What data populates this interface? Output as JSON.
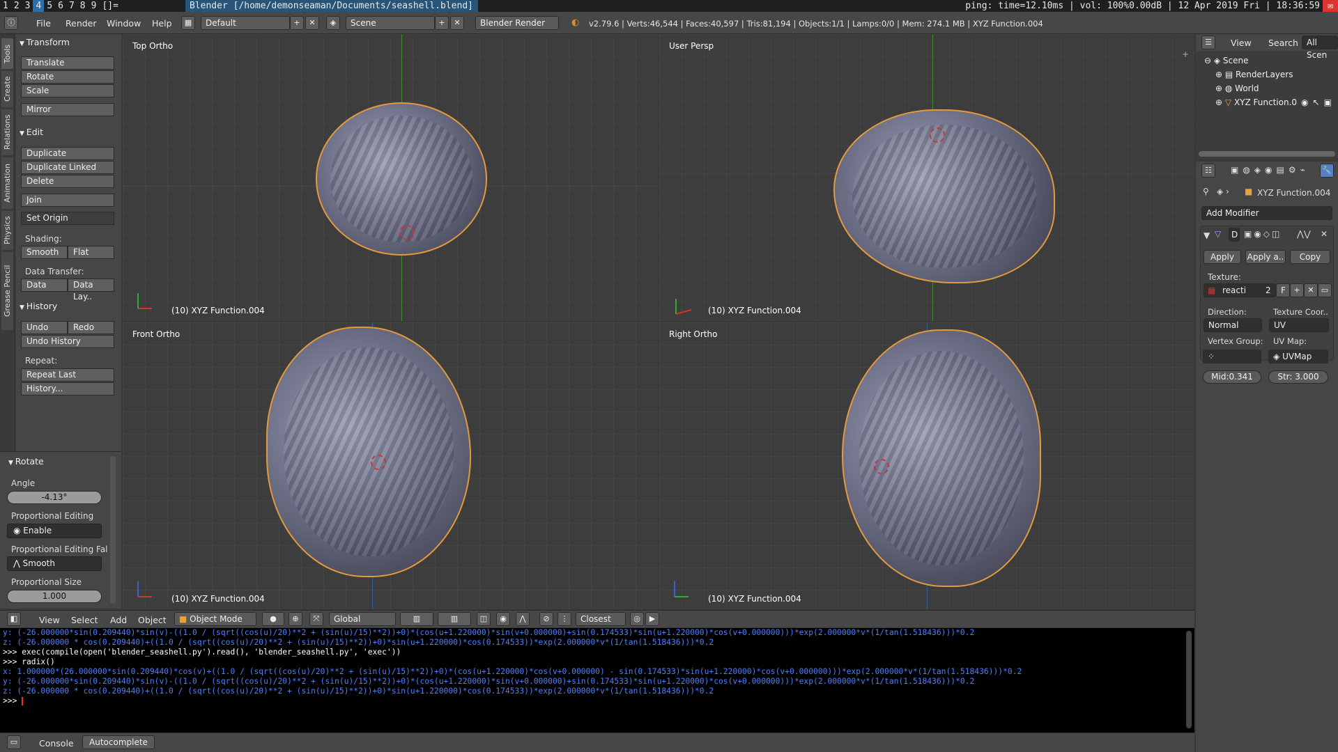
{
  "sysbar": {
    "workspaces": [
      "1",
      "2",
      "3",
      "4",
      "5",
      "6",
      "7",
      "8",
      "9"
    ],
    "active_workspace": "4",
    "layout_indicator": "[]=",
    "window_title": "Blender [/home/demonseaman/Documents/seashell.blend]",
    "status": "ping: time=12.10ms  |  vol: 100%0.00dB  |  12 Apr 2019 Fri  |  18:36:59"
  },
  "infobar": {
    "menus": [
      "File",
      "Render",
      "Window",
      "Help"
    ],
    "screen_layout": "Default",
    "scene": "Scene",
    "engine": "Blender Render",
    "stats": "v2.79.6 | Verts:46,544 | Faces:40,597 | Tris:81,194 | Objects:1/1 | Lamps:0/0 | Mem: 274.1 MB | XYZ Function.004"
  },
  "toolshelf": {
    "tabs": [
      "Tools",
      "Create",
      "Relations",
      "Animation",
      "Physics",
      "Grease Pencil"
    ],
    "transform": {
      "title": "Transform",
      "translate": "Translate",
      "rotate": "Rotate",
      "scale": "Scale",
      "mirror": "Mirror"
    },
    "edit": {
      "title": "Edit",
      "duplicate": "Duplicate",
      "duplicate_linked": "Duplicate Linked",
      "delete": "Delete",
      "join": "Join",
      "set_origin": "Set Origin",
      "shading_label": "Shading:",
      "smooth": "Smooth",
      "flat": "Flat",
      "data_transfer_label": "Data Transfer:",
      "data": "Data",
      "data_lay": "Data Lay.."
    },
    "history": {
      "title": "History",
      "undo": "Undo",
      "redo": "Redo",
      "undo_history": "Undo History",
      "repeat_label": "Repeat:",
      "repeat_last": "Repeat Last",
      "history_btn": "History..."
    }
  },
  "operator": {
    "title": "Rotate",
    "angle_label": "Angle",
    "angle_value": "-4.13°",
    "prop_edit_label": "Proportional Editing",
    "prop_edit_value": "Enable",
    "prop_falloff_label": "Proportional Editing Fal",
    "prop_falloff_value": "Smooth",
    "prop_size_label": "Proportional Size",
    "prop_size_value": "1.000"
  },
  "viewports": [
    {
      "name": "Top Ortho",
      "object": "(10) XYZ Function.004"
    },
    {
      "name": "User Persp",
      "object": "(10) XYZ Function.004"
    },
    {
      "name": "Front Ortho",
      "object": "(10) XYZ Function.004"
    },
    {
      "name": "Right Ortho",
      "object": "(10) XYZ Function.004"
    }
  ],
  "v3d_header": {
    "menus": [
      "View",
      "Select",
      "Add",
      "Object"
    ],
    "mode": "Object Mode",
    "orientation": "Global",
    "snap": "Closest"
  },
  "console": {
    "lines": [
      {
        "cls": "cblue",
        "text": "y: (-26.000000*sin(0.209440)*sin(v)-((1.0 / (sqrt((cos(u)/20)**2 + (sin(u)/15)**2))+0)*(cos(u+1.220000)*sin(v+0.000000)+sin(0.174533)*sin(u+1.220000)*cos(v+0.000000)))*exp(2.000000*v*(1/tan(1.518436)))*0.2"
      },
      {
        "cls": "cblue",
        "text": "z: (-26.000000 * cos(0.209440)+((1.0 / (sqrt((cos(u)/20)**2 + (sin(u)/15)**2))+0)*sin(u+1.220000)*cos(0.174533))*exp(2.000000*v*(1/tan(1.518436)))*0.2"
      },
      {
        "cls": "cwhite",
        "text": ""
      },
      {
        "cls": "cwhite",
        "text": ">>> exec(compile(open('blender_seashell.py').read(), 'blender_seashell.py', 'exec'))"
      },
      {
        "cls": "cwhite",
        "text": ">>> radix()"
      },
      {
        "cls": "cblue",
        "text": "x: 1.000000*(26.000000*sin(0.209440)*cos(v)+((1.0 / (sqrt((cos(u)/20)**2 + (sin(u)/15)**2))+0)*(cos(u+1.220000)*cos(v+0.000000) - sin(0.174533)*sin(u+1.220000)*cos(v+0.000000)))*exp(2.000000*v*(1/tan(1.518436)))*0.2"
      },
      {
        "cls": "cblue",
        "text": "y: (-26.000000*sin(0.209440)*sin(v)-((1.0 / (sqrt((cos(u)/20)**2 + (sin(u)/15)**2))+0)*(cos(u+1.220000)*sin(v+0.000000)+sin(0.174533)*sin(u+1.220000)*cos(v+0.000000)))*exp(2.000000*v*(1/tan(1.518436)))*0.2"
      },
      {
        "cls": "cblue",
        "text": "z: (-26.000000 * cos(0.209440)+((1.0 / (sqrt((cos(u)/20)**2 + (sin(u)/15)**2))+0)*sin(u+1.220000)*cos(0.174533))*exp(2.000000*v*(1/tan(1.518436)))*0.2"
      },
      {
        "cls": "cwhite",
        "text": ""
      },
      {
        "cls": "cwhite",
        "text": ">>> "
      }
    ],
    "tab_console": "Console",
    "tab_autocomplete": "Autocomplete"
  },
  "outliner": {
    "menus": [
      "View",
      "Search",
      "All Scen"
    ],
    "items": [
      "Scene",
      "RenderLayers",
      "World",
      "XYZ Function.0"
    ]
  },
  "properties": {
    "object_name": "XYZ Function.004",
    "add_modifier": "Add Modifier",
    "modifier_letter": "D",
    "apply": "Apply",
    "apply_as": "Apply a..",
    "copy": "Copy",
    "texture_label": "Texture:",
    "texture_value": "reacti",
    "texture_users": "2",
    "texture_fake": "F",
    "direction_label": "Direction:",
    "direction_value": "Normal",
    "texcoord_label": "Texture Coor..",
    "texcoord_value": "UV",
    "vgroup_label": "Vertex Group:",
    "uvmap_label": "UV Map:",
    "uvmap_value": "UVMap",
    "midlevel": "Mid:0.341",
    "strength": "Str: 3.000"
  }
}
